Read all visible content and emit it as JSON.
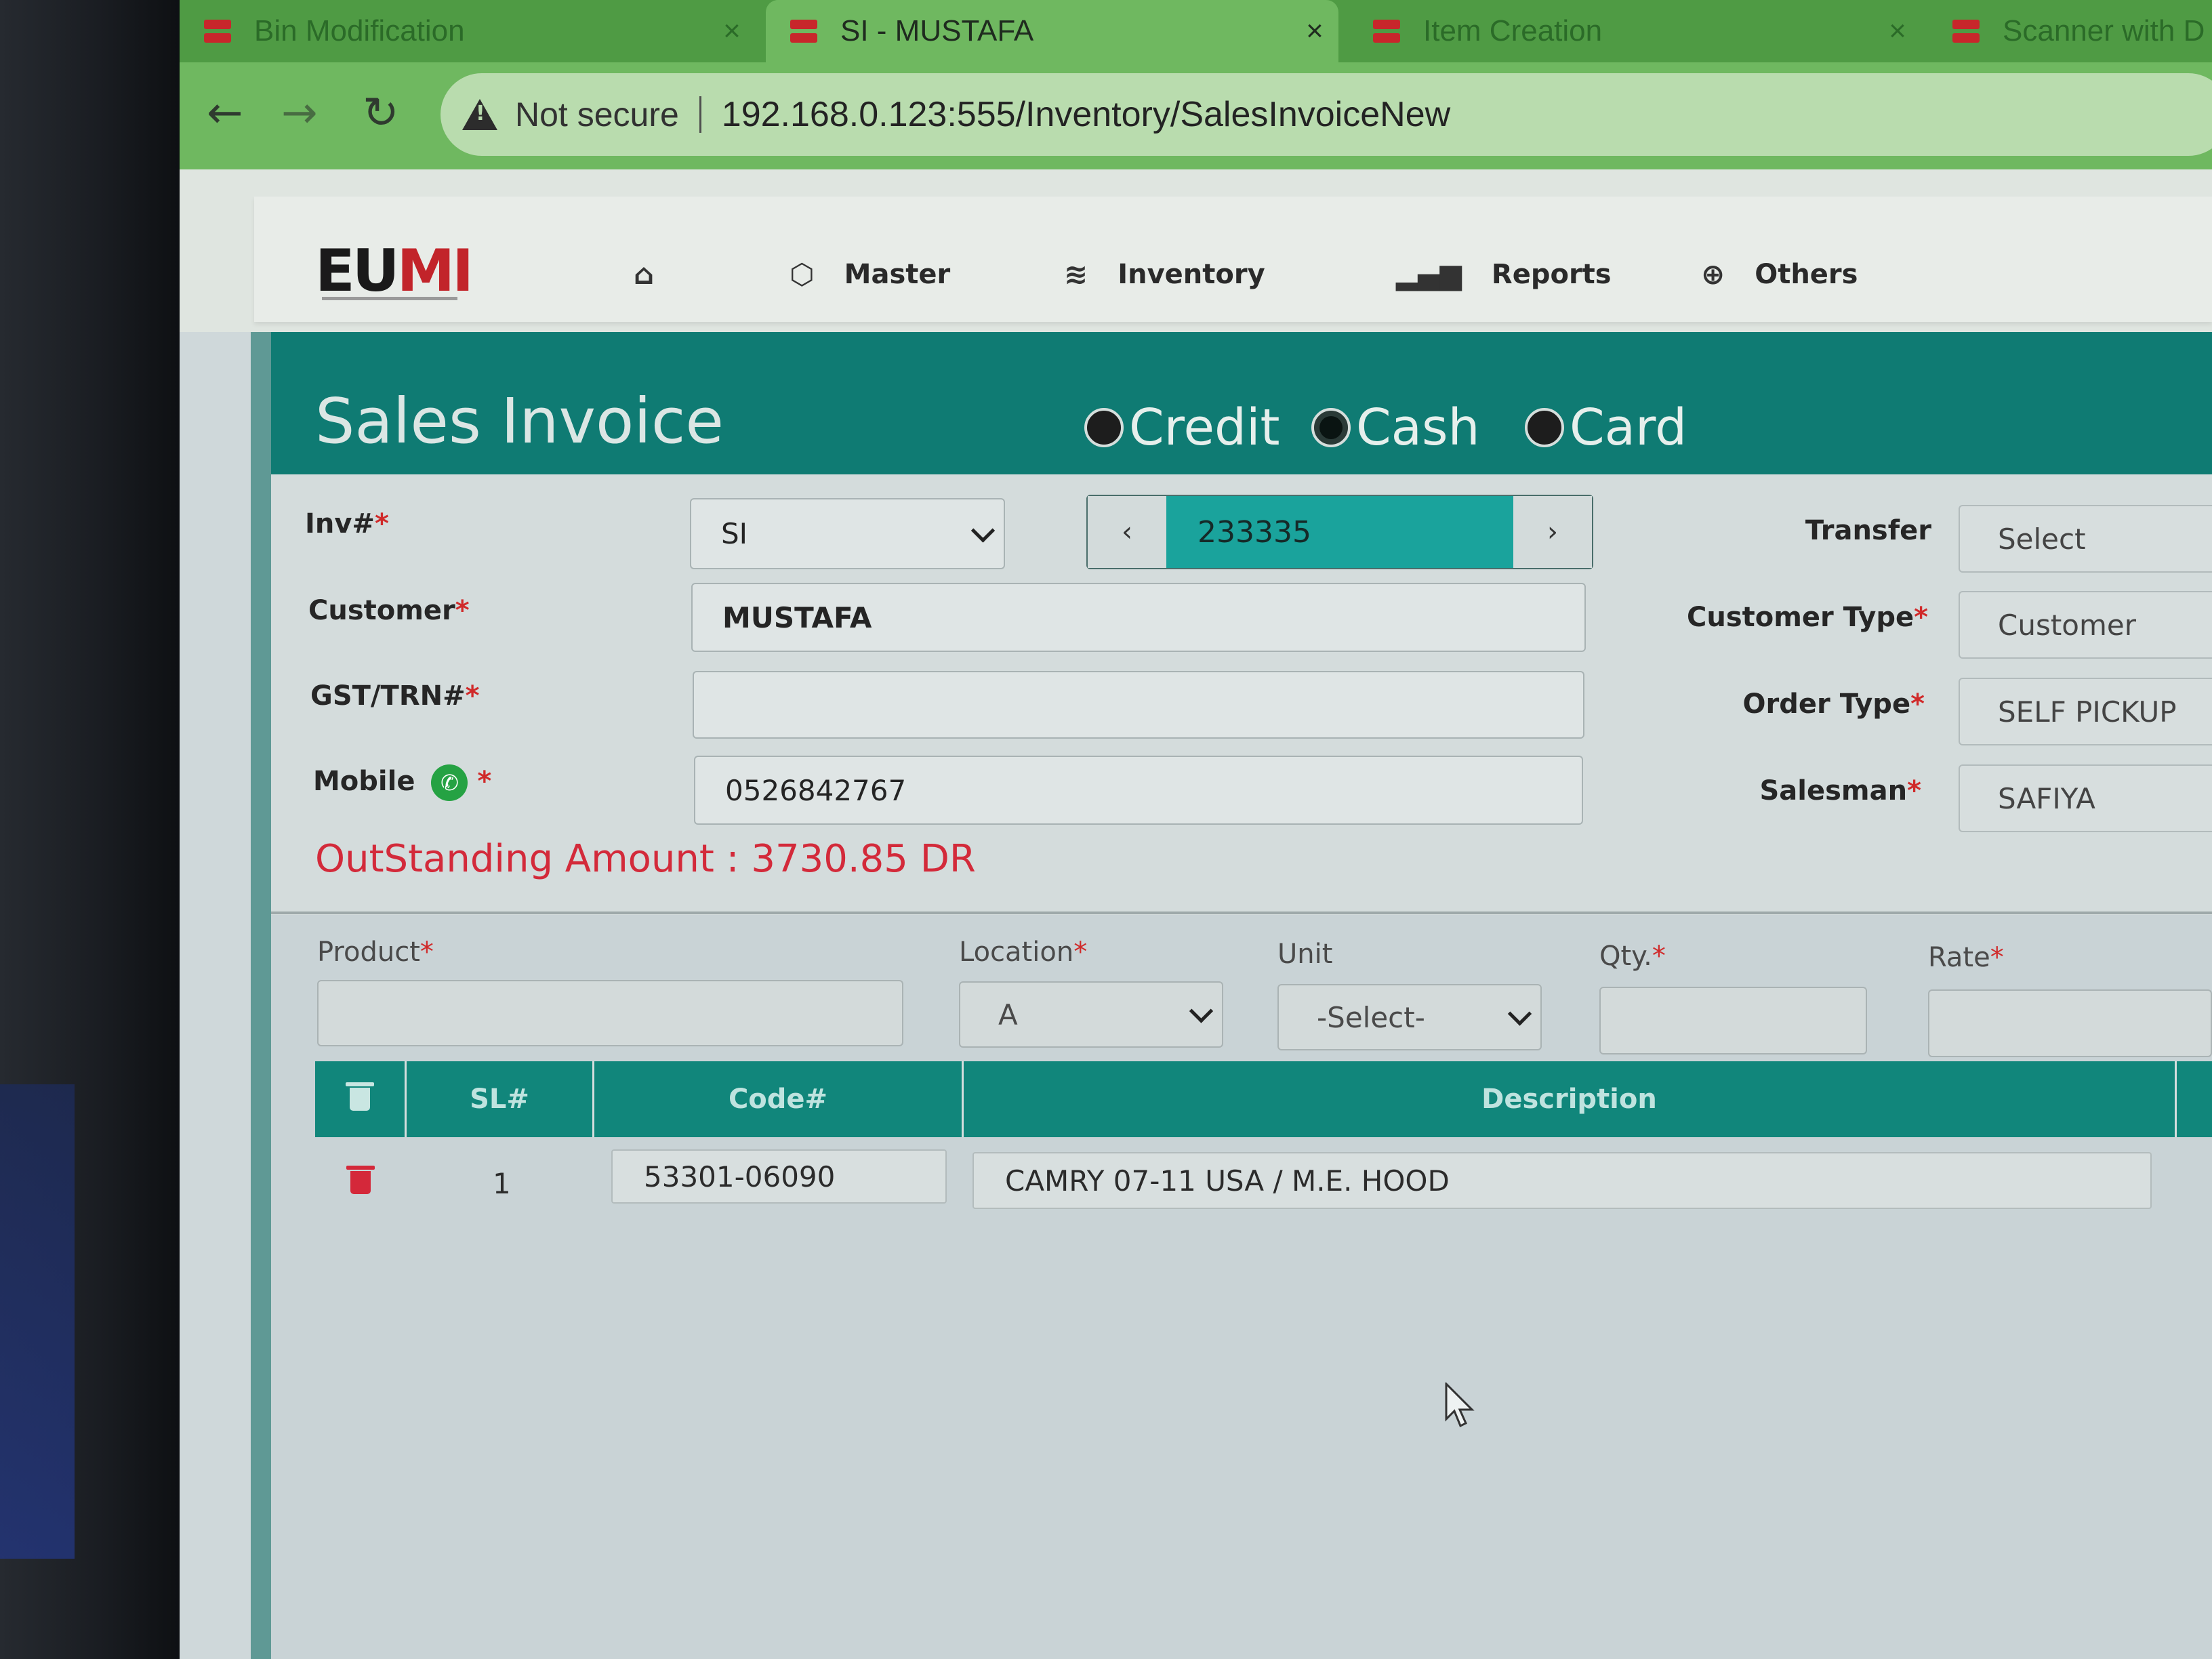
{
  "browser": {
    "tabs": [
      {
        "title": "Bin Modification",
        "active": false
      },
      {
        "title": "SI - MUSTAFA",
        "active": true
      },
      {
        "title": "Item Creation",
        "active": false
      },
      {
        "title": "Scanner with D",
        "active": false
      }
    ],
    "security_label": "Not secure",
    "url": "192.168.0.123:555/Inventory/SalesInvoiceNew"
  },
  "header": {
    "logo_left": "EU",
    "logo_right": "MI",
    "nav": [
      {
        "label": "",
        "icon": "home-icon"
      },
      {
        "label": "Master",
        "icon": "cube-icon"
      },
      {
        "label": "Inventory",
        "icon": "layers-icon"
      },
      {
        "label": "Reports",
        "icon": "bar-chart-icon"
      },
      {
        "label": "Others",
        "icon": "globe-icon"
      }
    ]
  },
  "page": {
    "title": "Sales Invoice",
    "payment_modes": [
      {
        "label": "Credit",
        "selected": false
      },
      {
        "label": "Cash",
        "selected": true
      },
      {
        "label": "Card",
        "selected": false
      }
    ]
  },
  "form": {
    "inv_label": "Inv#",
    "inv_prefix": "SI",
    "inv_number": "233335",
    "customer_label": "Customer",
    "customer_value": "MUSTAFA",
    "gst_label": "GST/TRN#",
    "gst_value": "",
    "mobile_label": "Mobile",
    "mobile_value": "0526842767",
    "transfer_label": "Transfer",
    "transfer_value": "Select",
    "customer_type_label": "Customer Type",
    "customer_type_value": "Customer",
    "order_type_label": "Order Type",
    "order_type_value": "SELF PICKUP",
    "salesman_label": "Salesman",
    "salesman_value": "SAFIYA",
    "outstanding": "OutStanding Amount : 3730.85 DR",
    "required_mark": "*"
  },
  "product_entry": {
    "product_label": "Product",
    "location_label": "Location",
    "location_value": "A",
    "unit_label": "Unit",
    "unit_value": "-Select-",
    "qty_label": "Qty.",
    "rate_label": "Rate"
  },
  "table": {
    "columns": [
      "SL#",
      "Code#",
      "Description"
    ],
    "rows": [
      {
        "sl": "1",
        "code": "53301-06090",
        "description": "CAMRY 07-11 USA / M.E. HOOD"
      }
    ]
  },
  "colors": {
    "accent": "#0f7b73",
    "required": "#d02a2a",
    "outstanding": "#d32a3a"
  }
}
